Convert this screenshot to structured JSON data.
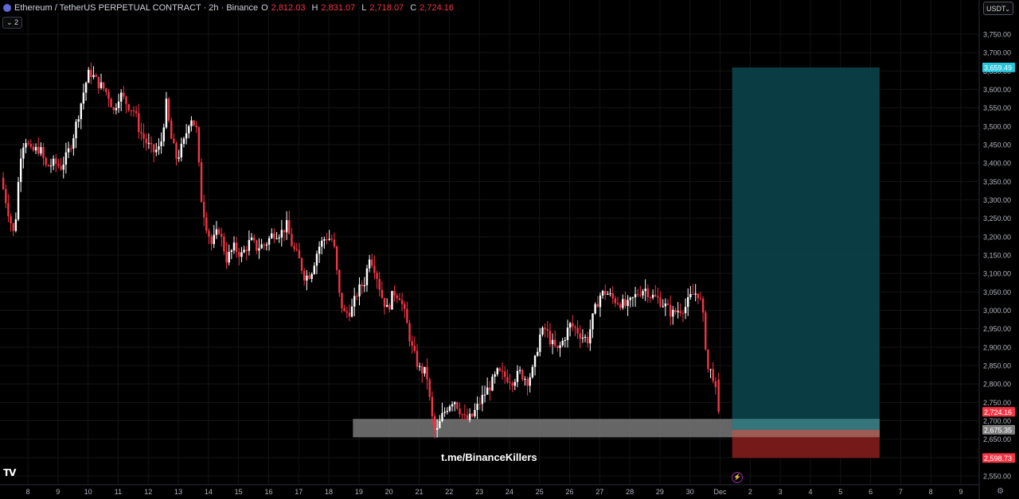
{
  "header": {
    "symbol": "Ethereum / TetherUS PERPETUAL CONTRACT · 2h · Binance",
    "ohlc": [
      {
        "key": "O",
        "value": "2,812.03"
      },
      {
        "key": "H",
        "value": "2,831.07"
      },
      {
        "key": "L",
        "value": "2,718.07"
      },
      {
        "key": "C",
        "value": "2,724.16"
      }
    ],
    "collapse_label": "⌄ 2"
  },
  "currency_button": "USDT",
  "watermark_text": "t.me/BinanceKillers",
  "tv_logo": "TV",
  "colors": {
    "up": "#ffffff",
    "down": "#f23645",
    "target_zone": "#0b4047",
    "entry_zone": "#3a7b82",
    "stop_zone": "#7c1a1a",
    "support_zone": "#808080",
    "target_label": "#26c6da",
    "price_label": "#f23645",
    "entry_label": "#808080"
  },
  "chart_data": {
    "type": "candlestick",
    "title": "Ethereum / TetherUS PERPETUAL CONTRACT · 2h · Binance",
    "ylim": [
      2530,
      3785
    ],
    "y_ticks": [
      "2,550.00",
      "2,600.00",
      "2,650.00",
      "2,700.00",
      "2,750.00",
      "2,800.00",
      "2,850.00",
      "2,900.00",
      "2,950.00",
      "3,000.00",
      "3,050.00",
      "3,100.00",
      "3,150.00",
      "3,200.00",
      "3,250.00",
      "3,300.00",
      "3,350.00",
      "3,400.00",
      "3,450.00",
      "3,500.00",
      "3,550.00",
      "3,600.00",
      "3,650.00",
      "3,700.00",
      "3,750.00"
    ],
    "x_ticks": [
      "8",
      "9",
      "10",
      "11",
      "12",
      "13",
      "14",
      "15",
      "16",
      "17",
      "18",
      "19",
      "20",
      "21",
      "22",
      "23",
      "24",
      "25",
      "26",
      "27",
      "28",
      "29",
      "30",
      "Dec",
      "2",
      "3",
      "4",
      "5",
      "6",
      "7",
      "8",
      "9"
    ],
    "x_tick_days": [
      8,
      9,
      10,
      11,
      12,
      13,
      14,
      15,
      16,
      17,
      18,
      19,
      20,
      21,
      22,
      23,
      24,
      25,
      26,
      27,
      28,
      29,
      30,
      31,
      32,
      33,
      34,
      35,
      36,
      37,
      38,
      39
    ],
    "x_range": [
      7.1,
      39.8
    ],
    "candle_end": 30.95,
    "candle_start": 7.1,
    "path": [
      [
        7.1,
        3360
      ],
      [
        7.4,
        3250
      ],
      [
        7.55,
        3200
      ],
      [
        7.75,
        3420
      ],
      [
        7.9,
        3470
      ],
      [
        8.1,
        3430
      ],
      [
        8.4,
        3440
      ],
      [
        8.6,
        3390
      ],
      [
        8.9,
        3400
      ],
      [
        9.1,
        3390
      ],
      [
        9.3,
        3420
      ],
      [
        9.5,
        3470
      ],
      [
        9.7,
        3540
      ],
      [
        9.9,
        3610
      ],
      [
        10.05,
        3650
      ],
      [
        10.3,
        3620
      ],
      [
        10.55,
        3600
      ],
      [
        10.7,
        3580
      ],
      [
        10.85,
        3540
      ],
      [
        11.05,
        3590
      ],
      [
        11.3,
        3560
      ],
      [
        11.55,
        3540
      ],
      [
        11.7,
        3490
      ],
      [
        11.9,
        3460
      ],
      [
        12.15,
        3430
      ],
      [
        12.4,
        3440
      ],
      [
        12.6,
        3560
      ],
      [
        12.75,
        3470
      ],
      [
        12.95,
        3410
      ],
      [
        13.2,
        3460
      ],
      [
        13.4,
        3530
      ],
      [
        13.6,
        3490
      ],
      [
        13.75,
        3310
      ],
      [
        13.9,
        3240
      ],
      [
        14.1,
        3180
      ],
      [
        14.35,
        3220
      ],
      [
        14.6,
        3140
      ],
      [
        14.85,
        3170
      ],
      [
        15.1,
        3150
      ],
      [
        15.4,
        3190
      ],
      [
        15.6,
        3170
      ],
      [
        15.9,
        3180
      ],
      [
        16.15,
        3210
      ],
      [
        16.4,
        3210
      ],
      [
        16.6,
        3230
      ],
      [
        16.8,
        3170
      ],
      [
        17.0,
        3140
      ],
      [
        17.2,
        3090
      ],
      [
        17.4,
        3100
      ],
      [
        17.65,
        3170
      ],
      [
        17.9,
        3200
      ],
      [
        18.15,
        3190
      ],
      [
        18.35,
        3040
      ],
      [
        18.5,
        2990
      ],
      [
        18.75,
        3000
      ],
      [
        18.95,
        3050
      ],
      [
        19.2,
        3080
      ],
      [
        19.35,
        3150
      ],
      [
        19.55,
        3110
      ],
      [
        19.75,
        3040
      ],
      [
        19.95,
        3000
      ],
      [
        20.15,
        3050
      ],
      [
        20.35,
        3040
      ],
      [
        20.55,
        2980
      ],
      [
        20.75,
        2900
      ],
      [
        21.0,
        2840
      ],
      [
        21.25,
        2830
      ],
      [
        21.4,
        2720
      ],
      [
        21.55,
        2660
      ],
      [
        21.75,
        2710
      ],
      [
        21.95,
        2740
      ],
      [
        22.15,
        2760
      ],
      [
        22.35,
        2730
      ],
      [
        22.55,
        2700
      ],
      [
        22.75,
        2710
      ],
      [
        22.95,
        2740
      ],
      [
        23.15,
        2770
      ],
      [
        23.4,
        2800
      ],
      [
        23.6,
        2830
      ],
      [
        23.85,
        2820
      ],
      [
        24.1,
        2810
      ],
      [
        24.35,
        2830
      ],
      [
        24.6,
        2810
      ],
      [
        24.8,
        2840
      ],
      [
        25.0,
        2930
      ],
      [
        25.2,
        2950
      ],
      [
        25.4,
        2910
      ],
      [
        25.6,
        2890
      ],
      [
        25.8,
        2920
      ],
      [
        26.0,
        2960
      ],
      [
        26.2,
        2950
      ],
      [
        26.4,
        2930
      ],
      [
        26.6,
        2920
      ],
      [
        26.8,
        2990
      ],
      [
        27.0,
        3040
      ],
      [
        27.2,
        3050
      ],
      [
        27.45,
        3030
      ],
      [
        27.7,
        3020
      ],
      [
        27.9,
        3010
      ],
      [
        28.1,
        3030
      ],
      [
        28.3,
        3050
      ],
      [
        28.5,
        3060
      ],
      [
        28.7,
        3040
      ],
      [
        28.95,
        3030
      ],
      [
        29.2,
        3010
      ],
      [
        29.4,
        2990
      ],
      [
        29.6,
        3000
      ],
      [
        29.85,
        3010
      ],
      [
        30.05,
        3040
      ],
      [
        30.25,
        3050
      ],
      [
        30.4,
        3010
      ],
      [
        30.5,
        2920
      ],
      [
        30.6,
        2840
      ],
      [
        30.75,
        2830
      ],
      [
        30.95,
        2724
      ]
    ],
    "last_price": 2724.16,
    "current_ohlc": {
      "open": 2812.03,
      "high": 2831.07,
      "low": 2718.07,
      "close": 2724.16
    },
    "support_zone": {
      "from_day": 18.8,
      "to_day": 36.3,
      "low": 2655,
      "high": 2705
    },
    "long_position": {
      "from_day": 31.4,
      "to_day": 36.3,
      "target": 3659.49,
      "entry": 2675.35,
      "stop": 2598.73
    },
    "price_labels": [
      {
        "value": 3659.49,
        "text": "3,659.49",
        "role": "target"
      },
      {
        "value": 2724.16,
        "text": "2,724.16",
        "role": "price"
      },
      {
        "value": 2675.35,
        "text": "2,675.35",
        "role": "entry"
      },
      {
        "value": 2598.73,
        "text": "2,598.73",
        "role": "stop"
      }
    ]
  }
}
